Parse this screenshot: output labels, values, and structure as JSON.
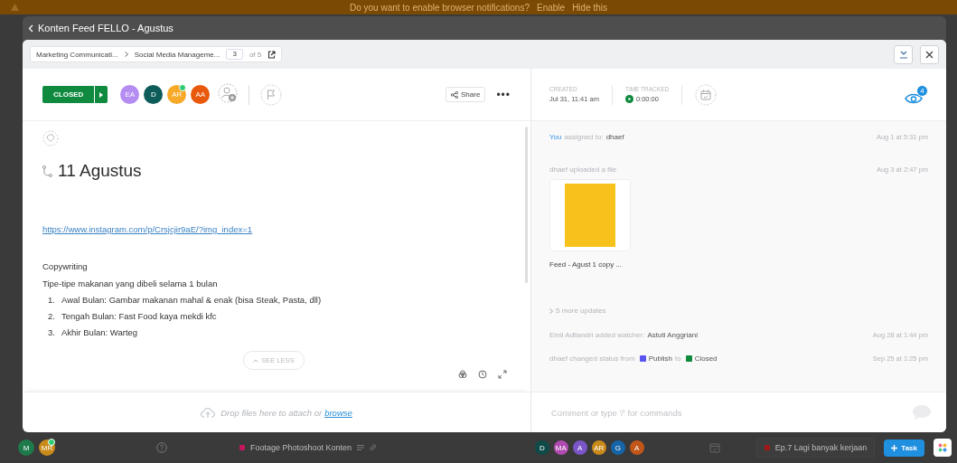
{
  "notification_bar": {
    "message": "Do you want to enable browser notifications?",
    "actions": [
      "Enable",
      "Hide this"
    ]
  },
  "task_window": {
    "title": "Konten Feed FELLO - Agustus"
  },
  "breadcrumb": {
    "items": [
      "Marketing Communicati...",
      "Social Media Manageme..."
    ],
    "page": "3",
    "page_total": "of 5"
  },
  "task_header": {
    "status": "CLOSED",
    "assignees": [
      {
        "initials": "EA",
        "color": "#b58cf2",
        "online": false
      },
      {
        "initials": "D",
        "color": "#0e5c5a",
        "online": false
      },
      {
        "initials": "AR",
        "color": "#f7a928",
        "online": true
      },
      {
        "initials": "AA",
        "color": "#e8590c",
        "online": false
      }
    ],
    "share": "Share",
    "more": "•••"
  },
  "task_meta": {
    "created_label": "CREATED",
    "created": "Jul 31, 11:41 am",
    "time_label": "TIME TRACKED",
    "time": "0:00:00",
    "watchers": "4"
  },
  "description": {
    "title": "11 Agustus",
    "link": "https://www.instagram.com/p/Crsjcjir9aE/?img_index=1",
    "heading": "Copywriting",
    "intro": "Tipe-tipe makanan yang dibeli selama 1 bulan",
    "list": [
      {
        "marker": "1.",
        "text": "Awal Bulan: Gambar makanan mahal & enak (bisa Steak, Pasta, dll)"
      },
      {
        "marker": "2.",
        "text": "Tengah Bulan: Fast Food kaya mekdi kfc"
      },
      {
        "marker": "3.",
        "text": "Akhir Bulan: Warteg"
      }
    ],
    "see_less": "SEE LESS"
  },
  "attach": {
    "text": "Drop files here to attach or",
    "link": "browse"
  },
  "activity": [
    {
      "kind": "assign",
      "actor": "You",
      "text": "assigned to:",
      "target": "dhaef",
      "time": "Aug 1 at 5:31 pm"
    },
    {
      "kind": "upload",
      "text": "dhaef uploaded a file",
      "file": "Feed - Agust 1 copy ...",
      "time": "Aug 3 at 2:47 pm"
    },
    {
      "kind": "more",
      "text": "5 more updates"
    },
    {
      "kind": "watcher",
      "text": "Emil Adliandri added watcher:",
      "target": "Astuti Anggriani",
      "time": "Aug 28 at 1:44 pm"
    },
    {
      "kind": "status",
      "text": "dhaef changed status from",
      "from": {
        "label": "Publish",
        "color": "#5b55f0"
      },
      "joiner": "to",
      "to": {
        "label": "Closed",
        "color": "#0e8a3c"
      },
      "time": "Sep 25 at 1:25 pm"
    }
  ],
  "comment": {
    "placeholder": "Comment or type '/' for commands"
  },
  "bottom_bar": {
    "users": [
      {
        "initials": "M",
        "color": "#1e7a4a",
        "online": false
      },
      {
        "initials": "MR",
        "color": "#c98a1a",
        "online": true
      }
    ],
    "tasks": [
      {
        "name": "Footage Photoshoot Konten",
        "color": "#c2185b"
      }
    ],
    "avatars": [
      {
        "initials": "D",
        "color": "#0e4a48"
      },
      {
        "initials": "MA",
        "color": "#b04ab0"
      },
      {
        "initials": "A",
        "color": "#7a55c8"
      },
      {
        "initials": "AR",
        "color": "#c98a1a"
      },
      {
        "initials": "G",
        "color": "#1565a8"
      },
      {
        "initials": "A",
        "color": "#c2561a"
      }
    ],
    "pinned": [
      {
        "name": "Ep.7 Lagi banyak kerjaan",
        "color": "#a01818"
      }
    ],
    "new_task": "Task"
  }
}
